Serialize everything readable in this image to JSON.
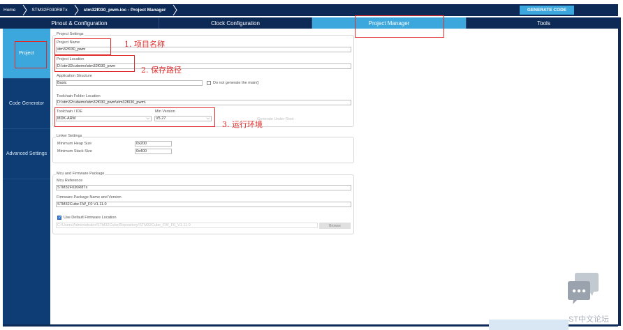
{
  "breadcrumb": {
    "items": [
      "Home",
      "STM32F030R8Tx",
      "stm32f030_pwm.ioc - Project Manager"
    ],
    "generate_button": "GENERATE CODE"
  },
  "tabs": [
    {
      "label": "Pinout & Configuration",
      "active": false
    },
    {
      "label": "Clock Configuration",
      "active": false
    },
    {
      "label": "Project Manager",
      "active": true
    },
    {
      "label": "Tools",
      "active": false
    }
  ],
  "sidebar": {
    "items": [
      {
        "label": "Project",
        "active": true
      },
      {
        "label": "Code Generator",
        "active": false
      },
      {
        "label": "Advanced Settings",
        "active": false
      }
    ]
  },
  "project_settings": {
    "title": "Project Settings",
    "project_name_label": "Project Name",
    "project_name_value": "stm32f030_pwm",
    "project_location_label": "Project Location",
    "project_location_value": "D:\\stm32cubemx\\stm32f030_pwm",
    "app_structure_label": "Application Structure",
    "app_structure_value": "Basic",
    "no_main_label": "Do not generate the main()",
    "toolchain_folder_label": "Toolchain Folder Location",
    "toolchain_folder_value": "D:\\stm32cubemx\\stm32f030_pwm\\stm32f030_pwm\\",
    "toolchain_ide_label": "Toolchain / IDE",
    "toolchain_ide_value": "MDK-ARM",
    "min_version_label": "Min Version",
    "min_version_value": "V5.27",
    "generate_under_root_label": "Generate Under Root"
  },
  "linker_settings": {
    "title": "Linker Settings",
    "heap_label": "Minimum Heap Size",
    "heap_value": "0x200",
    "stack_label": "Minimum Stack Size",
    "stack_value": "0x400"
  },
  "mcu_package": {
    "title": "Mcu and Firmware Package",
    "mcu_ref_label": "Mcu Reference",
    "mcu_ref_value": "STM32F030R8Tx",
    "fw_label": "Firmware Package Name and Version",
    "fw_value": "STM32Cube FW_F0 V1.11.0",
    "use_default_label": "Use Default Firmware Location",
    "fw_location_value": "C:/Users/Administrator/STM32Cube/Repository/STM32Cube_FW_F0_V1.11.0",
    "browse_label": "Browse"
  },
  "annotations": {
    "a1": "1. 项目名称",
    "a2": "2. 保存路径",
    "a3": "3. 运行环境"
  },
  "watermark": "ST中文论坛",
  "colors": {
    "navy": "#0d2a57",
    "sidebar": "#0d3d74",
    "accent": "#3ba7dc",
    "annotation_red": "#e02b2b"
  }
}
